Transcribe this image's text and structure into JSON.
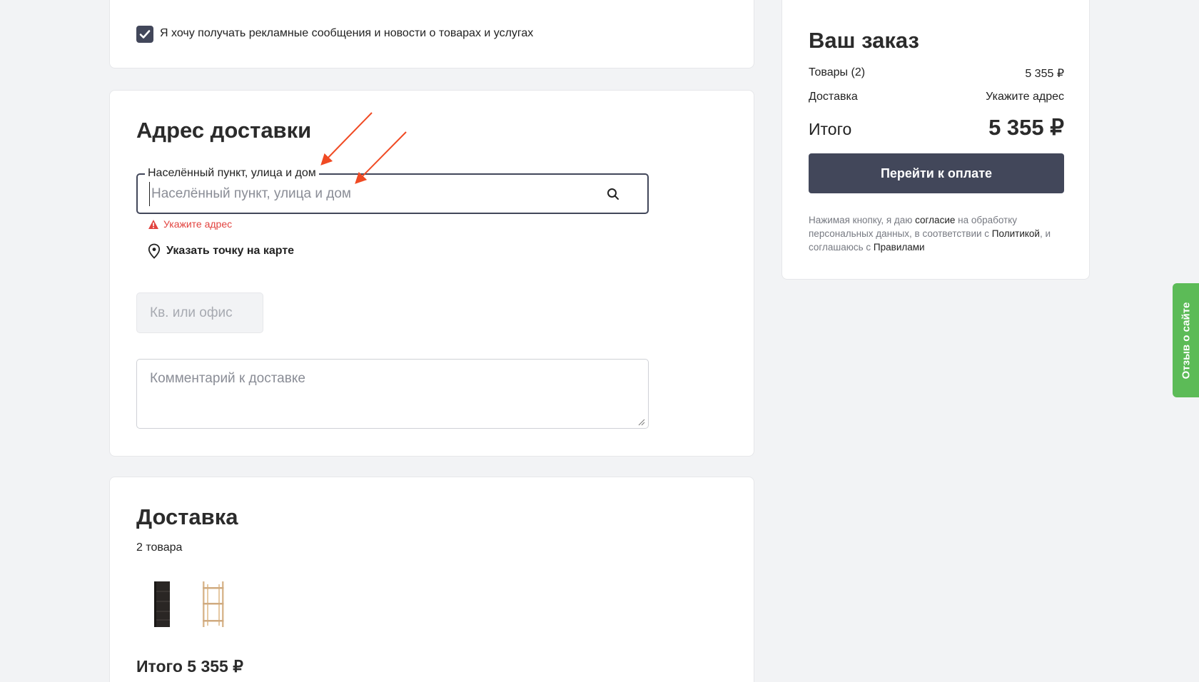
{
  "consent": {
    "checked": true,
    "text": "Я хочу получать рекламные сообщения и новости о товарах и услугах"
  },
  "address_section": {
    "title": "Адрес доставки",
    "address_label": "Населённый пункт, улица и дом",
    "address_placeholder": "Населённый пункт, улица и дом",
    "error": "Укажите адрес",
    "map_link": "Указать точку на карте",
    "apartment_placeholder": "Кв. или офис",
    "comment_placeholder": "Комментарий к доставке"
  },
  "delivery_section": {
    "title": "Доставка",
    "items_count": "2 товара",
    "total": "Итого 5 355 ₽"
  },
  "order": {
    "title": "Ваш заказ",
    "items_label": "Товары (2)",
    "items_value": "5 355 ₽",
    "delivery_label": "Доставка",
    "delivery_value": "Укажите адрес",
    "total_label": "Итого",
    "total_value": "5 355 ₽",
    "pay_button": "Перейти к оплате",
    "legal_1": "Нажимая кнопку, я даю ",
    "legal_link_consent": "согласие",
    "legal_2": " на обработку персональных данных, в соответствии с ",
    "legal_link_policy": "Политикой",
    "legal_3": ", и соглашаюсь с ",
    "legal_link_rules": "Правилами"
  },
  "feedback_tab": "Отзыв о сайте",
  "colors": {
    "accent_dark": "#42475a",
    "error": "#e2433f",
    "feedback_green": "#5cbb57",
    "annotation_arrow": "#f04a23"
  }
}
